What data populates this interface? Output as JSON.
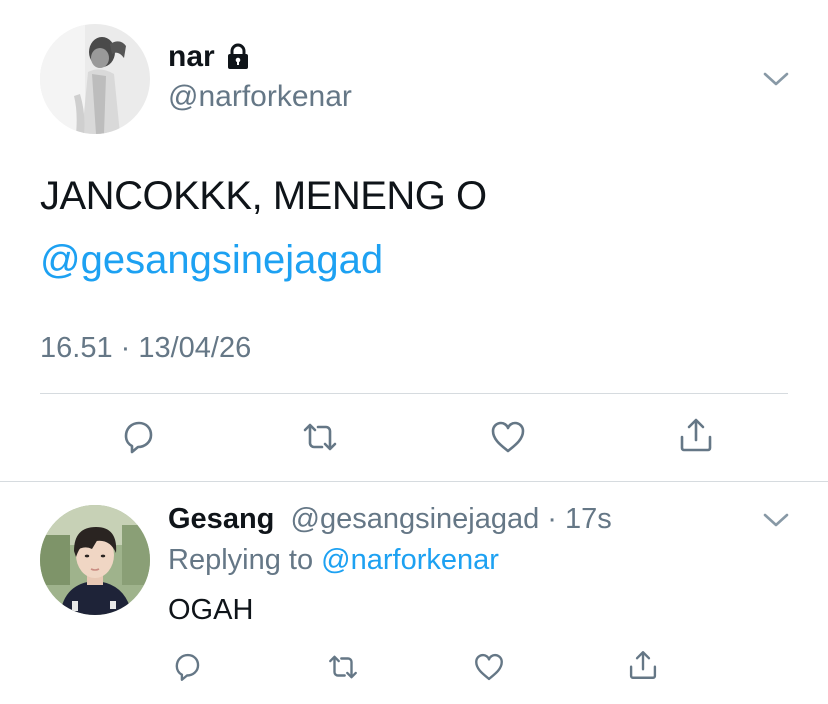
{
  "main_tweet": {
    "display_name": "nar",
    "handle": "@narforkenar",
    "text": "JANCOKKK, MENENG O",
    "mention": "@gesangsinejagad",
    "timestamp": "16.51 · 13/04/26",
    "icons": [
      "lock-icon",
      "chevron-down-icon",
      "reply-icon",
      "retweet-icon",
      "like-icon",
      "share-icon"
    ]
  },
  "reply_tweet": {
    "display_name": "Gesang",
    "handle": "@gesangsinejagad",
    "separator": " · ",
    "time": "17s",
    "replying_prefix": "Replying to ",
    "replying_to": "@narforkenar",
    "text": "OGAH",
    "icons": [
      "chevron-down-icon",
      "reply-icon",
      "retweet-icon",
      "like-icon",
      "share-icon"
    ]
  },
  "colors": {
    "text_primary": "#0f1419",
    "text_secondary": "#657786",
    "link": "#1da1f2",
    "divider": "#d6dbdf"
  }
}
